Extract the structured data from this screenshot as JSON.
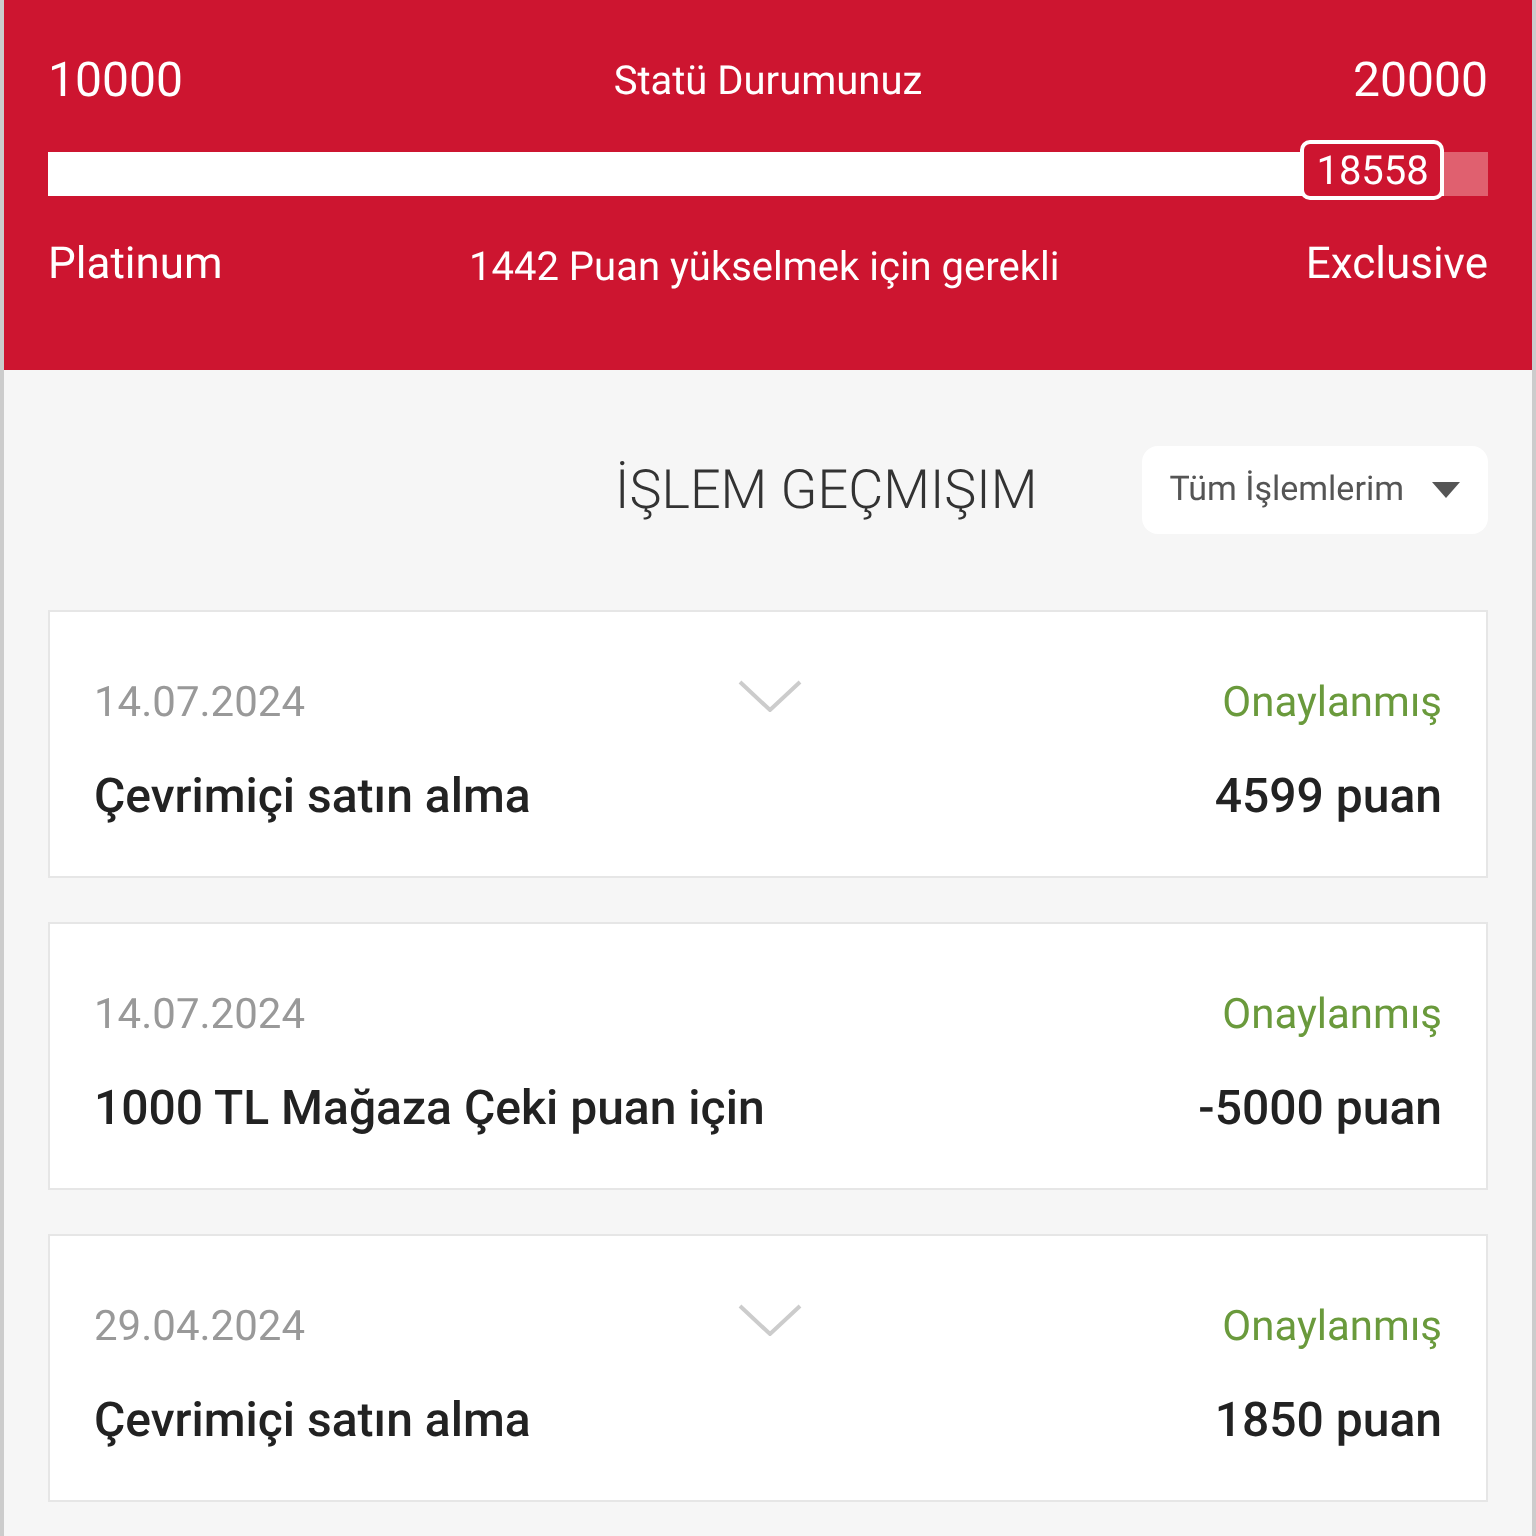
{
  "status": {
    "min": "10000",
    "title": "Statü Durumunuz",
    "max": "20000",
    "level": 0.97,
    "current": "18558",
    "current_tier": "Platinum",
    "message": "1442 Puan yükselmek için gerekli",
    "next_tier": "Exclusive"
  },
  "history": {
    "title": "İŞLEM GEÇMIŞIM",
    "filter": "Tüm İşlemlerim"
  },
  "transactions": [
    {
      "date": "14.07.2024",
      "status": "Onaylanmış",
      "description": "Çevrimiçi satın alma",
      "points": "4599 puan",
      "expandable": true
    },
    {
      "date": "14.07.2024",
      "status": "Onaylanmış",
      "description": "1000 TL Mağaza Çeki puan için",
      "points": "-5000 puan",
      "expandable": false
    },
    {
      "date": "29.04.2024",
      "status": "Onaylanmış",
      "description": "Çevrimiçi satın alma",
      "points": "1850 puan",
      "expandable": true
    }
  ]
}
